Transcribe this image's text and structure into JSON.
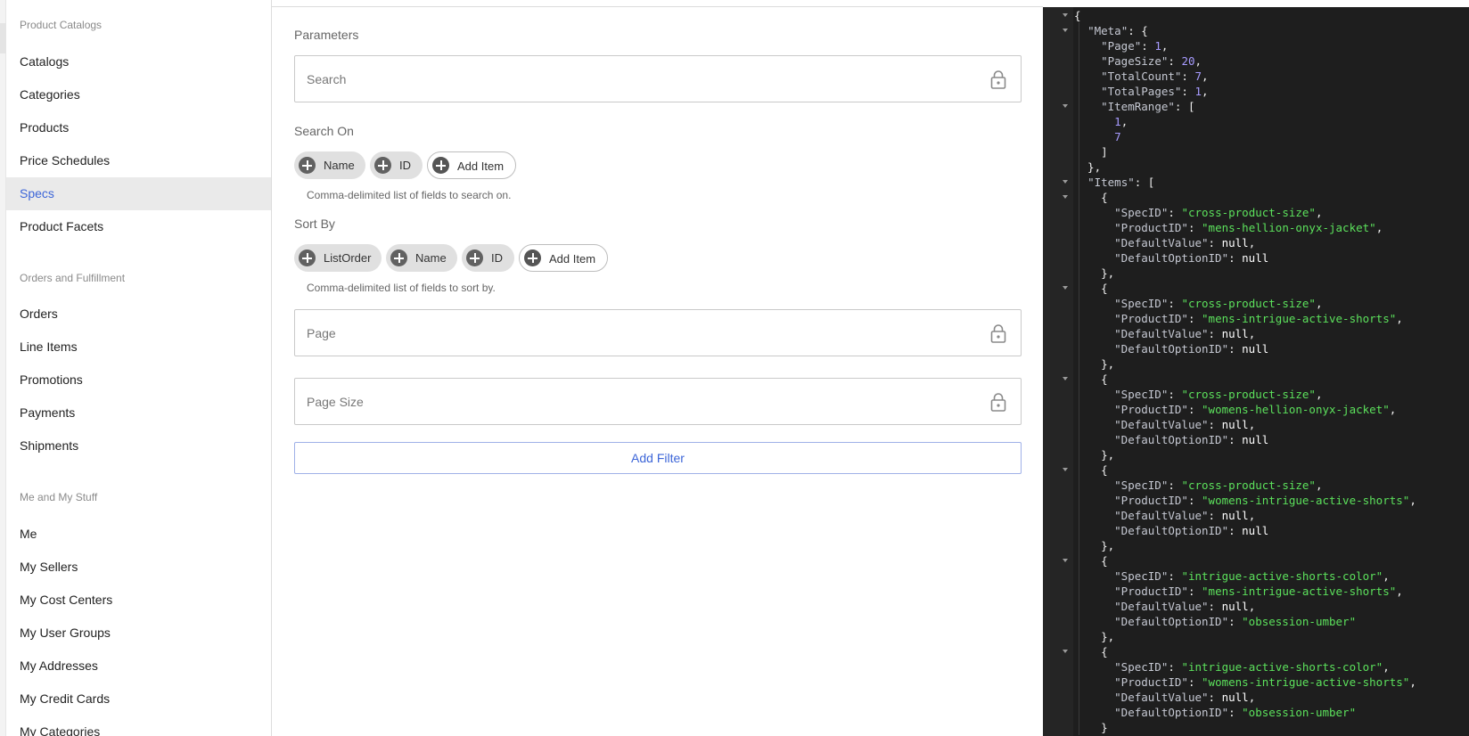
{
  "sidebar": {
    "groups": [
      {
        "title": "Product Catalogs",
        "items": [
          "Catalogs",
          "Categories",
          "Products",
          "Price Schedules",
          "Specs",
          "Product Facets"
        ]
      },
      {
        "title": "Orders and Fulfillment",
        "items": [
          "Orders",
          "Line Items",
          "Promotions",
          "Payments",
          "Shipments"
        ]
      },
      {
        "title": "Me and My Stuff",
        "items": [
          "Me",
          "My Sellers",
          "My Cost Centers",
          "My User Groups",
          "My Addresses",
          "My Credit Cards",
          "My Categories"
        ]
      }
    ],
    "active": "Specs"
  },
  "main": {
    "parameters_label": "Parameters",
    "search_placeholder": "Search",
    "search_on_label": "Search On",
    "search_on_chips": [
      "Name",
      "ID"
    ],
    "add_item_label": "Add Item",
    "search_on_helper": "Comma-delimited list of fields to search on.",
    "sort_by_label": "Sort By",
    "sort_by_chips": [
      "ListOrder",
      "Name",
      "ID"
    ],
    "sort_by_helper": "Comma-delimited list of fields to sort by.",
    "page_placeholder": "Page",
    "page_size_placeholder": "Page Size",
    "add_filter_label": "Add Filter"
  },
  "response": {
    "Meta": {
      "Page": 1,
      "PageSize": 20,
      "TotalCount": 7,
      "TotalPages": 1,
      "ItemRange": [
        1,
        7
      ]
    },
    "Items": [
      {
        "SpecID": "cross-product-size",
        "ProductID": "mens-hellion-onyx-jacket",
        "DefaultValue": null,
        "DefaultOptionID": null
      },
      {
        "SpecID": "cross-product-size",
        "ProductID": "mens-intrigue-active-shorts",
        "DefaultValue": null,
        "DefaultOptionID": null
      },
      {
        "SpecID": "cross-product-size",
        "ProductID": "womens-hellion-onyx-jacket",
        "DefaultValue": null,
        "DefaultOptionID": null
      },
      {
        "SpecID": "cross-product-size",
        "ProductID": "womens-intrigue-active-shorts",
        "DefaultValue": null,
        "DefaultOptionID": null
      },
      {
        "SpecID": "intrigue-active-shorts-color",
        "ProductID": "mens-intrigue-active-shorts",
        "DefaultValue": null,
        "DefaultOptionID": "obsession-umber"
      },
      {
        "SpecID": "intrigue-active-shorts-color",
        "ProductID": "womens-intrigue-active-shorts",
        "DefaultValue": null,
        "DefaultOptionID": "obsession-umber"
      }
    ]
  }
}
